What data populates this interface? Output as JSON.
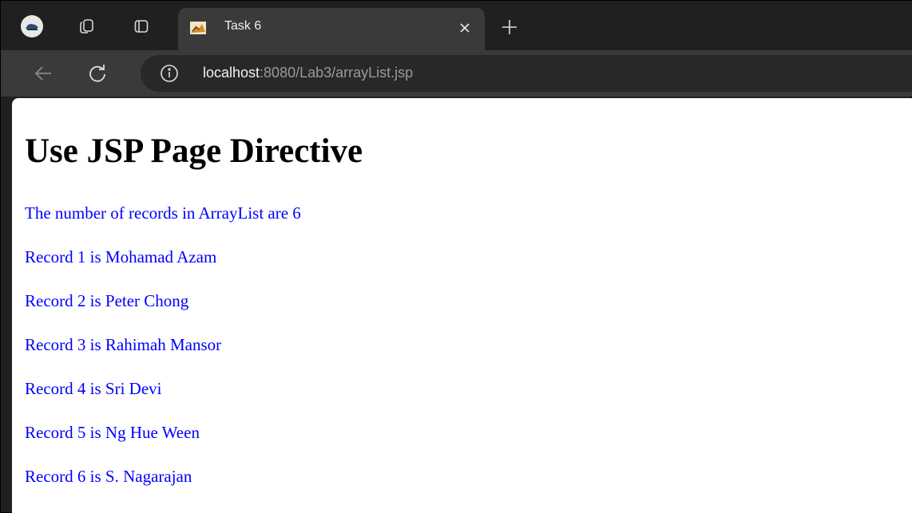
{
  "browser": {
    "tab": {
      "title": "Task 6"
    },
    "address": {
      "host": "localhost",
      "rest": ":8080/Lab3/arrayList.jsp"
    }
  },
  "page": {
    "title": "Use JSP Page Directive",
    "count_line": "The number of records in ArrayList are 6",
    "records": [
      "Record 1 is Mohamad Azam",
      "Record 2 is Peter Chong",
      "Record 3 is Rahimah Mansor",
      "Record 4 is Sri Devi",
      "Record 5 is Ng Hue Ween",
      "Record 6 is S. Nagarajan"
    ]
  },
  "colors": {
    "record_text": "#0000ff",
    "chrome_dark": "#202020",
    "chrome_toolbar": "#3a3a3a"
  }
}
